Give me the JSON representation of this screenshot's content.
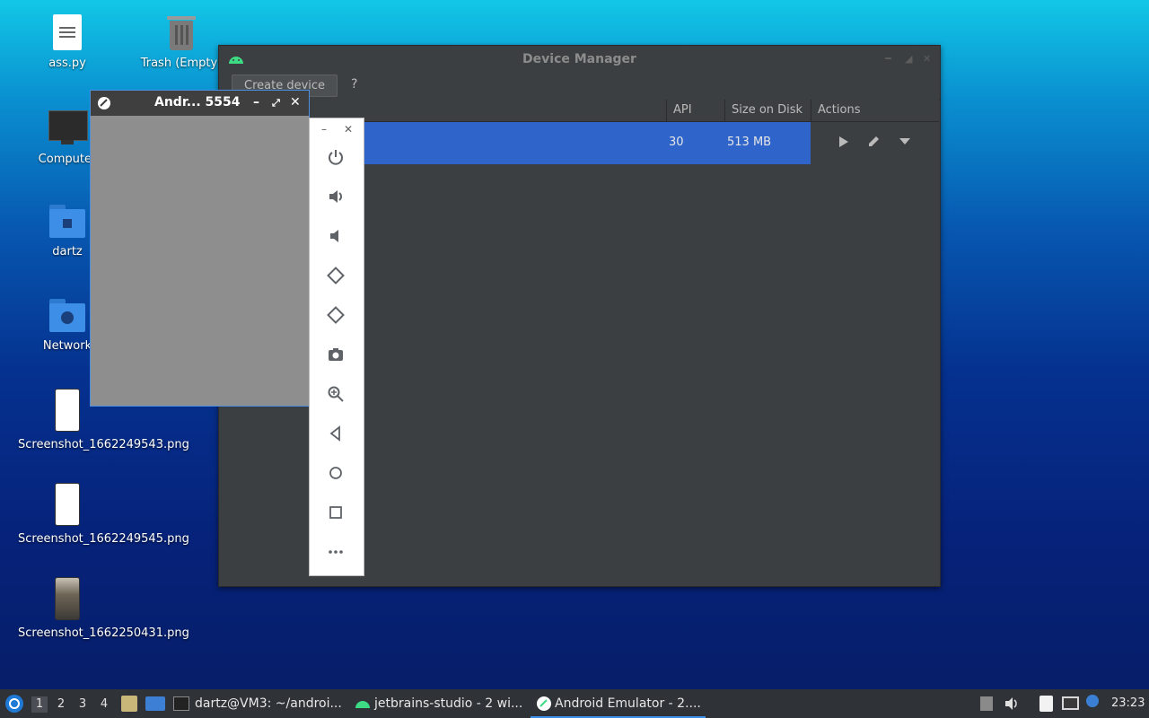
{
  "desktop": {
    "icons": [
      {
        "label": "ass.py"
      },
      {
        "label": "Trash (Empty)"
      },
      {
        "label": "Computer"
      },
      {
        "label": "dartz"
      },
      {
        "label": "Network"
      },
      {
        "label": "Screenshot_1662249543.png"
      },
      {
        "label": "Screenshot_1662249545.png"
      },
      {
        "label": "Screenshot_1662250431.png"
      }
    ]
  },
  "device_manager": {
    "title": "Device Manager",
    "create_button": "Create device",
    "help": "?",
    "columns": {
      "api": "API",
      "size": "Size on Disk",
      "actions": "Actions"
    },
    "rows": [
      {
        "api": "30",
        "size": "513 MB"
      }
    ]
  },
  "emulator": {
    "title": "Andr... 5554",
    "toolbar_items": [
      "power-icon",
      "volume-up-icon",
      "volume-down-icon",
      "rotate-left-icon",
      "rotate-right-icon",
      "camera-icon",
      "zoom-icon",
      "back-icon",
      "home-icon",
      "overview-icon",
      "more-icon"
    ]
  },
  "taskbar": {
    "workspaces": [
      "1",
      "2",
      "3",
      "4"
    ],
    "tasks": [
      {
        "label": "dartz@VM3: ~/androi..."
      },
      {
        "label": "jetbrains-studio - 2 wi..."
      },
      {
        "label": "Android Emulator - 2...."
      }
    ],
    "clock": "23:23"
  },
  "colors": {
    "selection": "#2f65ca",
    "panel": "#3c3f41",
    "taskbar": "#2f3237"
  }
}
